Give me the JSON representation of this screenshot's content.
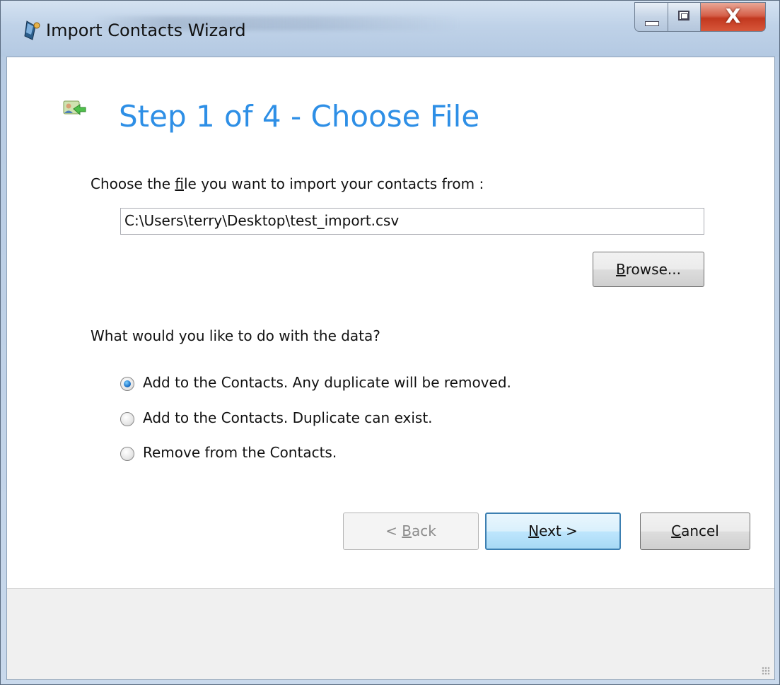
{
  "window": {
    "title": "Import Contacts Wizard",
    "close_glyph": "X",
    "accent_color": "#2e8fe6"
  },
  "step": {
    "title": "Step 1 of 4 - Choose File",
    "icon": "contacts-import-icon"
  },
  "file": {
    "label_pre": "Choose the ",
    "label_mnemonic": "f",
    "label_post": "ile you want to import your contacts from :",
    "path": "C:\\Users\\terry\\Desktop\\test_import.csv",
    "browse_mnemonic": "B",
    "browse_rest": "rowse..."
  },
  "action": {
    "question": "What would you like to do with the data?",
    "options": [
      {
        "label": "Add to the Contacts. Any duplicate will be removed.",
        "selected": true
      },
      {
        "label": "Add to the Contacts. Duplicate can exist.",
        "selected": false
      },
      {
        "label": "Remove from the Contacts.",
        "selected": false
      }
    ]
  },
  "footer": {
    "back_pre": "< ",
    "back_mnemonic": "B",
    "back_rest": "ack",
    "next_mnemonic": "N",
    "next_rest": "ext >",
    "cancel_mnemonic": "C",
    "cancel_rest": "ancel"
  }
}
